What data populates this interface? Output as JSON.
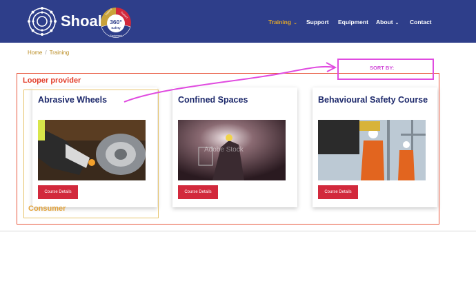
{
  "brand": {
    "name": "Shoal",
    "badge_main": "360°",
    "badge_sub": "Safety",
    "badge_ring_left": "Training",
    "badge_ring_right": "Support",
    "badge_ring_bottom": "Equipment"
  },
  "nav": {
    "items": [
      {
        "label": "Training",
        "dropdown": true,
        "active": true
      },
      {
        "label": "Support",
        "dropdown": false,
        "active": false
      },
      {
        "label": "Equipment",
        "dropdown": false,
        "active": false
      },
      {
        "label": "About",
        "dropdown": true,
        "active": false
      },
      {
        "label": "Contact",
        "dropdown": false,
        "active": false
      }
    ],
    "caret": "⌄"
  },
  "breadcrumb": {
    "home": "Home",
    "separator": "/",
    "current": "Training"
  },
  "annotations": {
    "looper": "Looper provider",
    "consumer": "Consumer",
    "sort": "SORT BY:"
  },
  "cards": [
    {
      "title": "Abrasive Wheels",
      "button": "Course Details"
    },
    {
      "title": "Confined Spaces",
      "button": "Course Details",
      "watermark": "Adobe Stock"
    },
    {
      "title": "Behavioural Safety Course",
      "button": "Course Details"
    }
  ],
  "colors": {
    "header_bg": "#2e3e8a",
    "nav_active": "#e0a62a",
    "card_title": "#1e2a6c",
    "button_bg": "#d2293c",
    "annotation_red": "#e8553a",
    "annotation_yellow": "#e6c36a",
    "annotation_magenta": "#e04be0"
  }
}
